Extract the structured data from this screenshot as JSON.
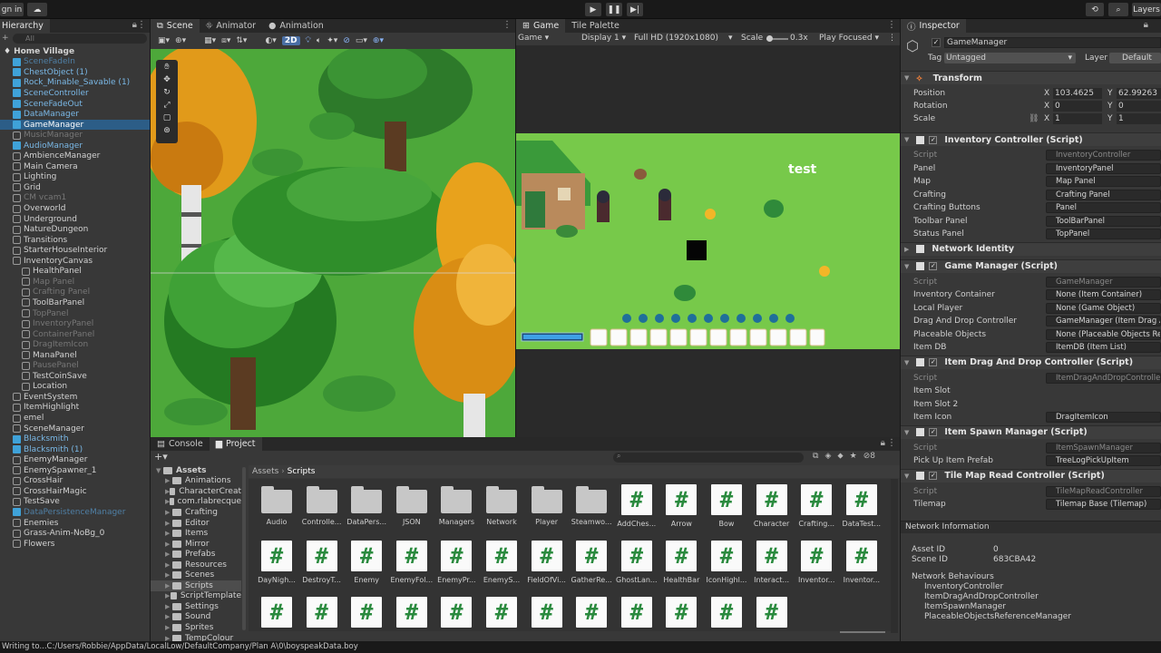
{
  "topbar": {
    "signin": "gn in",
    "layers": "Layers"
  },
  "hierarchy": {
    "tab": "Hierarchy",
    "search_placeholder": "All",
    "items": [
      {
        "label": "Home Village",
        "indent": 0,
        "kind": "scene",
        "style": "bold"
      },
      {
        "label": "SceneFadeIn",
        "indent": 1,
        "kind": "blue",
        "style": "dimblue"
      },
      {
        "label": "ChestObject (1)",
        "indent": 1,
        "kind": "blue",
        "style": "blue"
      },
      {
        "label": "Rock_Minable_Savable (1)",
        "indent": 1,
        "kind": "blue",
        "style": "blue"
      },
      {
        "label": "SceneController",
        "indent": 1,
        "kind": "blue",
        "style": "blue"
      },
      {
        "label": "SceneFadeOut",
        "indent": 1,
        "kind": "blue",
        "style": "blue"
      },
      {
        "label": "DataManager",
        "indent": 1,
        "kind": "blue",
        "style": "blue"
      },
      {
        "label": "GameManager",
        "indent": 1,
        "kind": "blue",
        "style": "sel"
      },
      {
        "label": "MusicManager",
        "indent": 1,
        "kind": "gray",
        "style": "dim"
      },
      {
        "label": "AudioManager",
        "indent": 1,
        "kind": "blue",
        "style": "blue"
      },
      {
        "label": "AmbienceManager",
        "indent": 1,
        "kind": "gray",
        "style": "normal"
      },
      {
        "label": "Main Camera",
        "indent": 1,
        "kind": "gray",
        "style": "normal"
      },
      {
        "label": "Lighting",
        "indent": 1,
        "kind": "gray",
        "style": "normal"
      },
      {
        "label": "Grid",
        "indent": 1,
        "kind": "gray",
        "style": "normal"
      },
      {
        "label": "CM vcam1",
        "indent": 1,
        "kind": "gray",
        "style": "dim"
      },
      {
        "label": "Overworld",
        "indent": 1,
        "kind": "gray",
        "style": "normal"
      },
      {
        "label": "Underground",
        "indent": 1,
        "kind": "gray",
        "style": "normal"
      },
      {
        "label": "NatureDungeon",
        "indent": 1,
        "kind": "gray",
        "style": "normal"
      },
      {
        "label": "Transitions",
        "indent": 1,
        "kind": "gray",
        "style": "normal"
      },
      {
        "label": "StarterHouseInterior",
        "indent": 1,
        "kind": "gray",
        "style": "normal"
      },
      {
        "label": "InventoryCanvas",
        "indent": 1,
        "kind": "gray",
        "style": "normal"
      },
      {
        "label": "HealthPanel",
        "indent": 2,
        "kind": "gray",
        "style": "normal"
      },
      {
        "label": "Map Panel",
        "indent": 2,
        "kind": "gray",
        "style": "dim"
      },
      {
        "label": "Crafting Panel",
        "indent": 2,
        "kind": "gray",
        "style": "dim"
      },
      {
        "label": "ToolBarPanel",
        "indent": 2,
        "kind": "gray",
        "style": "normal"
      },
      {
        "label": "TopPanel",
        "indent": 2,
        "kind": "gray",
        "style": "dim"
      },
      {
        "label": "InventoryPanel",
        "indent": 2,
        "kind": "gray",
        "style": "dim"
      },
      {
        "label": "ContainerPanel",
        "indent": 2,
        "kind": "gray",
        "style": "dim"
      },
      {
        "label": "DragItemIcon",
        "indent": 2,
        "kind": "gray",
        "style": "dim"
      },
      {
        "label": "ManaPanel",
        "indent": 2,
        "kind": "gray",
        "style": "normal"
      },
      {
        "label": "PausePanel",
        "indent": 2,
        "kind": "gray",
        "style": "dim"
      },
      {
        "label": "TestCoinSave",
        "indent": 2,
        "kind": "gray",
        "style": "normal"
      },
      {
        "label": "Location",
        "indent": 2,
        "kind": "gray",
        "style": "normal"
      },
      {
        "label": "EventSystem",
        "indent": 1,
        "kind": "gray",
        "style": "normal"
      },
      {
        "label": "ItemHighlight",
        "indent": 1,
        "kind": "gray",
        "style": "normal"
      },
      {
        "label": "emel",
        "indent": 1,
        "kind": "gray",
        "style": "normal"
      },
      {
        "label": "SceneManager",
        "indent": 1,
        "kind": "gray",
        "style": "normal"
      },
      {
        "label": "Blacksmith",
        "indent": 1,
        "kind": "blue",
        "style": "blue"
      },
      {
        "label": "Blacksmith (1)",
        "indent": 1,
        "kind": "blue",
        "style": "blue"
      },
      {
        "label": "EnemyManager",
        "indent": 1,
        "kind": "gray",
        "style": "normal"
      },
      {
        "label": "EnemySpawner_1",
        "indent": 1,
        "kind": "gray",
        "style": "normal"
      },
      {
        "label": "CrossHair",
        "indent": 1,
        "kind": "gray",
        "style": "normal"
      },
      {
        "label": "CrossHairMagic",
        "indent": 1,
        "kind": "gray",
        "style": "normal"
      },
      {
        "label": "TestSave",
        "indent": 1,
        "kind": "gray",
        "style": "normal"
      },
      {
        "label": "DataPersistenceManager",
        "indent": 1,
        "kind": "blue",
        "style": "dimblue"
      },
      {
        "label": "Enemies",
        "indent": 1,
        "kind": "gray",
        "style": "normal"
      },
      {
        "label": "Grass-Anim-NoBg_0",
        "indent": 1,
        "kind": "gray",
        "style": "normal"
      },
      {
        "label": "Flowers",
        "indent": 1,
        "kind": "gray",
        "style": "normal"
      }
    ]
  },
  "scene": {
    "tabs": [
      "Scene",
      "Animator",
      "Animation"
    ],
    "mode_2d": "2D"
  },
  "game": {
    "tabs": [
      "Game",
      "Tile Palette"
    ],
    "display_select": "Game",
    "display": "Display 1",
    "resolution": "Full HD (1920x1080)",
    "scale_label": "Scale",
    "scale_value": "0.3x",
    "play_mode": "Play Focused",
    "overlay_text": "test"
  },
  "inspector": {
    "tab": "Inspector",
    "object_name": "GameManager",
    "tag_label": "Tag",
    "tag_value": "Untagged",
    "layer_label": "Layer",
    "layer_value": "Default",
    "transform": {
      "title": "Transform",
      "position_label": "Position",
      "pos_x": "103.4625",
      "pos_y": "62.99263",
      "rotation_label": "Rotation",
      "rot_x": "0",
      "rot_y": "0",
      "scale_label": "Scale",
      "scale_x": "1",
      "scale_y": "1"
    },
    "components": [
      {
        "title": "Inventory Controller (Script)",
        "fields": [
          {
            "label": "Script",
            "value": "InventoryController",
            "dim": true
          },
          {
            "label": "Panel",
            "value": "InventoryPanel"
          },
          {
            "label": "Map",
            "value": "Map Panel"
          },
          {
            "label": "Crafting",
            "value": "Crafting Panel"
          },
          {
            "label": "Crafting Buttons",
            "value": "Panel"
          },
          {
            "label": "Toolbar Panel",
            "value": "ToolBarPanel"
          },
          {
            "label": "Status Panel",
            "value": "TopPanel"
          }
        ]
      },
      {
        "title": "Network Identity",
        "fields": []
      },
      {
        "title": "Game Manager (Script)",
        "fields": [
          {
            "label": "Script",
            "value": "GameManager",
            "dim": true
          },
          {
            "label": "Inventory Container",
            "value": "None (Item Container)"
          },
          {
            "label": "Local Player",
            "value": "None (Game Object)"
          },
          {
            "label": "Drag And Drop Controller",
            "value": "GameManager (Item Drag An"
          },
          {
            "label": "Placeable Objects",
            "value": "None (Placeable Objects Refere"
          },
          {
            "label": "Item DB",
            "value": "ItemDB (Item List)"
          }
        ]
      },
      {
        "title": "Item Drag And Drop Controller (Script)",
        "fields": [
          {
            "label": "Script",
            "value": "ItemDragAndDropController",
            "dim": true
          },
          {
            "label": "Item Slot",
            "value": ""
          },
          {
            "label": "Item Slot 2",
            "value": ""
          },
          {
            "label": "Item Icon",
            "value": "DragItemIcon"
          }
        ]
      },
      {
        "title": "Item Spawn Manager (Script)",
        "fields": [
          {
            "label": "Script",
            "value": "ItemSpawnManager",
            "dim": true
          },
          {
            "label": "Pick Up Item Prefab",
            "value": "TreeLogPickUpItem"
          }
        ]
      },
      {
        "title": "Tile Map Read Controller (Script)",
        "fields": [
          {
            "label": "Script",
            "value": "TileMapReadController",
            "dim": true
          },
          {
            "label": "Tilemap",
            "value": "Tilemap Base (Tilemap)"
          }
        ]
      }
    ],
    "network_info": {
      "title": "Network Information",
      "asset_id_label": "Asset ID",
      "asset_id": "0",
      "scene_id_label": "Scene ID",
      "scene_id": "683CBA42",
      "behaviours_label": "Network Behaviours",
      "behaviours": [
        "InventoryController",
        "ItemDragAndDropController",
        "ItemSpawnManager",
        "PlaceableObjectsReferenceManager"
      ]
    }
  },
  "project": {
    "tabs": [
      "Console",
      "Project"
    ],
    "breadcrumb": [
      "Assets",
      "Scripts"
    ],
    "hidden_count": "8",
    "tree": [
      "Assets",
      "Animations",
      "CharacterCreat",
      "com.rlabrecque",
      "Crafting",
      "Editor",
      "Items",
      "Mirror",
      "Prefabs",
      "Resources",
      "Scenes",
      "Scripts",
      "ScriptTemplate",
      "Settings",
      "Sound",
      "Sprites",
      "TempColour"
    ],
    "assets": [
      {
        "label": "Audio",
        "type": "folder"
      },
      {
        "label": "Controlle...",
        "type": "folder"
      },
      {
        "label": "DataPers...",
        "type": "folder"
      },
      {
        "label": "JSON",
        "type": "folder"
      },
      {
        "label": "Managers",
        "type": "folder"
      },
      {
        "label": "Network",
        "type": "folder"
      },
      {
        "label": "Player",
        "type": "folder"
      },
      {
        "label": "Steamwo...",
        "type": "folder"
      },
      {
        "label": "AddChes...",
        "type": "script"
      },
      {
        "label": "Arrow",
        "type": "script"
      },
      {
        "label": "Bow",
        "type": "script"
      },
      {
        "label": "Character",
        "type": "script"
      },
      {
        "label": "Crafting...",
        "type": "script"
      },
      {
        "label": "DataTest...",
        "type": "script"
      },
      {
        "label": "DayNigh...",
        "type": "script"
      },
      {
        "label": "DestroyT...",
        "type": "script"
      },
      {
        "label": "Enemy",
        "type": "script"
      },
      {
        "label": "EnemyFol...",
        "type": "script"
      },
      {
        "label": "EnemyPr...",
        "type": "script"
      },
      {
        "label": "EnemyS...",
        "type": "script"
      },
      {
        "label": "FieldOfVi...",
        "type": "script"
      },
      {
        "label": "GatherRe...",
        "type": "script"
      },
      {
        "label": "GhostLan...",
        "type": "script"
      },
      {
        "label": "HealthBar",
        "type": "script"
      },
      {
        "label": "IconHighl...",
        "type": "script"
      },
      {
        "label": "Interact...",
        "type": "script"
      },
      {
        "label": "Inventor...",
        "type": "script"
      },
      {
        "label": "Inventor...",
        "type": "script"
      },
      {
        "label": "",
        "type": "script"
      },
      {
        "label": "",
        "type": "script"
      },
      {
        "label": "",
        "type": "script"
      },
      {
        "label": "",
        "type": "script"
      },
      {
        "label": "",
        "type": "script"
      },
      {
        "label": "",
        "type": "script"
      },
      {
        "label": "",
        "type": "script"
      },
      {
        "label": "",
        "type": "script"
      },
      {
        "label": "",
        "type": "script"
      },
      {
        "label": "",
        "type": "script"
      },
      {
        "label": "",
        "type": "script"
      },
      {
        "label": "",
        "type": "script"
      }
    ]
  },
  "status_bar": "Writing to...C:/Users/Robbie/AppData/LocalLow/DefaultCompany/Plan A\\0\\boyspeakData.boy"
}
